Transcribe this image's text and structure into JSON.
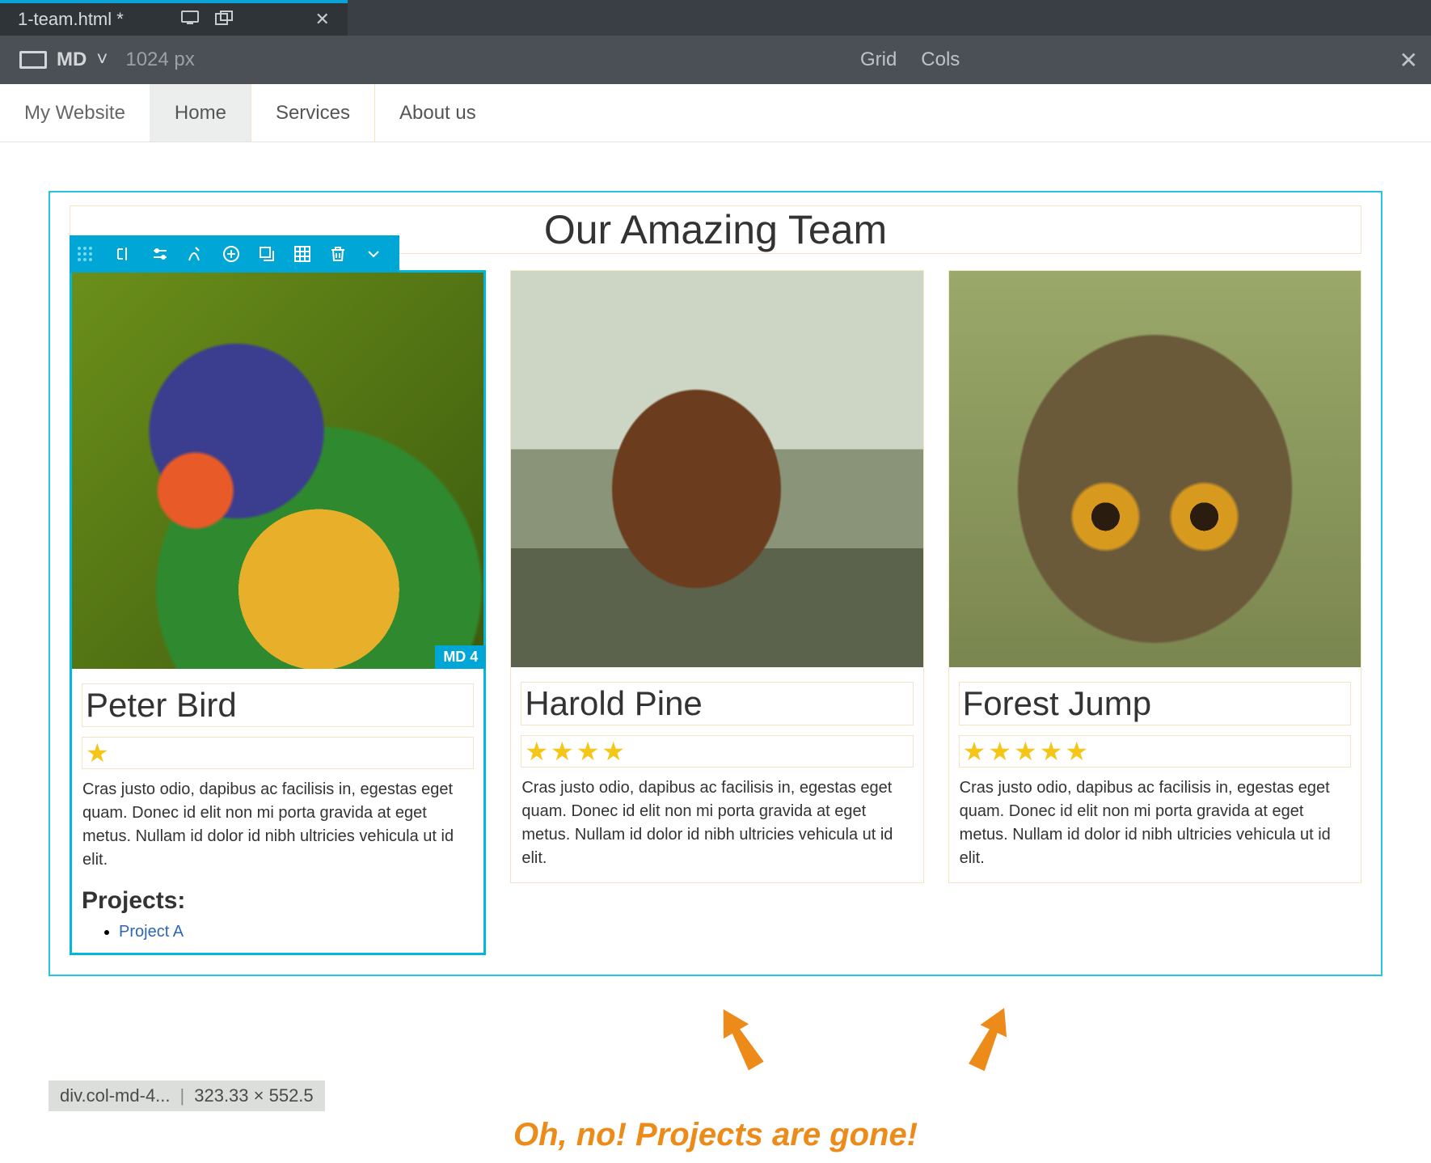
{
  "tab": {
    "filename": "1-team.html *",
    "close_glyph": "✕"
  },
  "subbar": {
    "breakpoint": "MD",
    "width_label": "1024 px",
    "btn_grid": "Grid",
    "btn_cols": "Cols"
  },
  "page": {
    "brand": "My Website",
    "nav": [
      "Home",
      "Services",
      "About us"
    ],
    "section_title": "Our Amazing Team",
    "team": [
      {
        "name": "Peter Bird",
        "stars": 1,
        "desc": "Cras justo odio, dapibus ac facilisis in, egestas eget quam. Donec id elit non mi porta gravida at eget metus. Nullam id dolor id nibh ultricies vehicula ut id elit.",
        "projects_heading": "Projects:",
        "projects": [
          "Project A"
        ],
        "selected": true,
        "badge": "MD 4",
        "image": "parrot"
      },
      {
        "name": "Harold Pine",
        "stars": 4,
        "desc": "Cras justo odio, dapibus ac facilisis in, egestas eget quam. Donec id elit non mi porta gravida at eget metus. Nullam id dolor id nibh ultricies vehicula ut id elit.",
        "image": "horse"
      },
      {
        "name": "Forest Jump",
        "stars": 5,
        "desc": "Cras justo odio, dapibus ac facilisis in, egestas eget quam. Donec id elit non mi porta gravida at eget metus. Nullam id dolor id nibh ultricies vehicula ut id elit.",
        "image": "owl"
      }
    ]
  },
  "statusbar": {
    "selector": "div.col-md-4...",
    "dims": "323.33 × 552.5"
  },
  "annotation": {
    "text": "Oh, no! Projects are gone!"
  }
}
